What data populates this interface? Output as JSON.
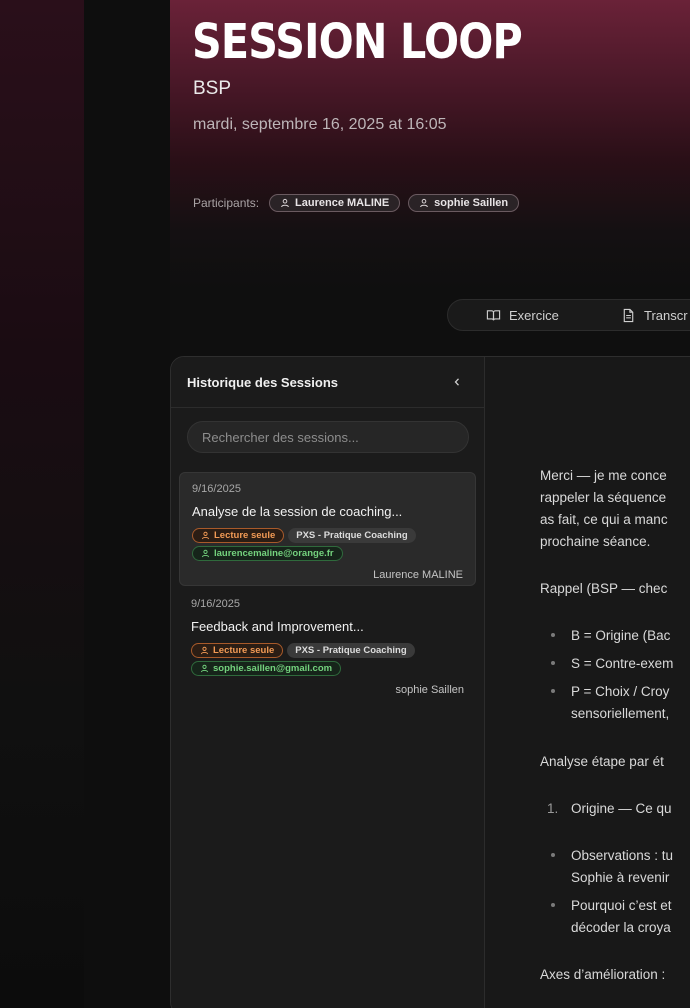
{
  "header": {
    "title": "SESSION LOOP",
    "subtitle": "BSP",
    "datetime": "mardi, septembre 16, 2025 at 16:05",
    "participants_label": "Participants:",
    "participants": [
      "Laurence MALINE",
      "sophie Saillen"
    ]
  },
  "tabs": [
    {
      "label": "Exercice",
      "icon": "book-open-icon"
    },
    {
      "label": "Transcr",
      "icon": "file-text-icon"
    }
  ],
  "sidebar": {
    "title": "Historique des Sessions",
    "search_placeholder": "Rechercher des sessions...",
    "sessions": [
      {
        "date": "9/16/2025",
        "title": "Analyse de la session de coaching...",
        "readonly_label": "Lecture seule",
        "program": "PXS - Pratique Coaching",
        "email": "laurencemaline@orange.fr",
        "owner": "Laurence MALINE"
      },
      {
        "date": "9/16/2025",
        "title": "Feedback and Improvement...",
        "readonly_label": "Lecture seule",
        "program": "PXS - Pratique Coaching",
        "email": "sophie.saillen@gmail.com",
        "owner": "sophie Saillen"
      }
    ]
  },
  "content": {
    "p1_lines": [
      "Merci — je me conce",
      "rappeler la séquence",
      "as fait, ce qui a manc",
      "prochaine séance."
    ],
    "p2": "Rappel (BSP — chec",
    "bullets": [
      "B = Origine (Bac",
      "S = Contre-exem",
      "P = Choix / Croy",
      "sensoriellement,"
    ],
    "p3": "Analyse étape par ét",
    "ordered_number": "1.",
    "ordered_item": "Origine — Ce qu",
    "sub_bullets": [
      "Observations : tu",
      "Sophie à revenir",
      "Pourquoi c’est et",
      "décoder la croya"
    ],
    "p4": "Axes d’amélioration :"
  },
  "colors": {
    "accent": "#6a2238",
    "readonly": "#f19a55",
    "email": "#74d27e"
  }
}
